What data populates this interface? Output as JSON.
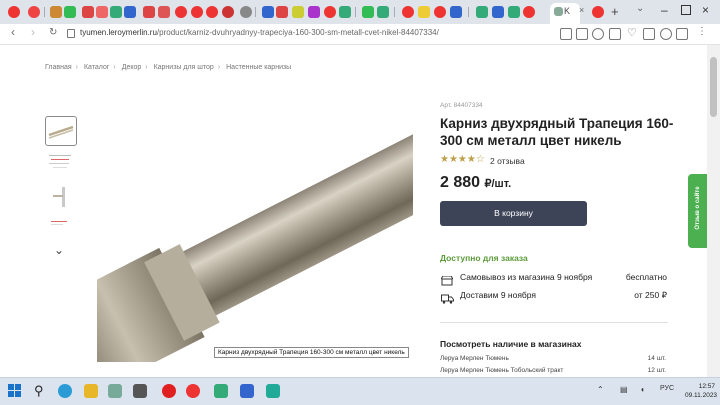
{
  "browser": {
    "active_tab_label": "K",
    "url_domain": "tyumen.leroymerlin.ru",
    "url_path": "/product/karniz-dvuhryadnyy-trapeciya-160-300-sm-metall-cvet-nikel-84407334/"
  },
  "breadcrumb": [
    "Главная",
    "Каталог",
    "Декор",
    "Карнизы для штор",
    "Настенные карнизы"
  ],
  "product": {
    "sku": "Арт. 84407334",
    "title": "Карниз двухрядный Трапеция 160-300 см металл цвет никель",
    "rating_stars": "★★★★☆",
    "rating": 3.5,
    "reviews": "2 отзыва",
    "price": "2 880",
    "price_unit": "₽/шт.",
    "cart_button": "В корзину",
    "availability": "Доступно для заказа",
    "image_caption": "Карниз двухрядный Трапеция 160-300 см металл цвет никель"
  },
  "delivery": [
    {
      "icon": "store-icon",
      "label": "Самовывоз из магазина 9 ноября",
      "value": "бесплатно"
    },
    {
      "icon": "truck-icon",
      "label": "Доставим 9 ноября",
      "value": "от 250 ₽"
    }
  ],
  "stock": {
    "title": "Посмотреть наличие в магазинах",
    "stores": [
      {
        "name": "Леруа Мерлен Тюмень",
        "qty": "14 шт."
      },
      {
        "name": "Леруа Мерлен Тюмень Тобольский тракт",
        "qty": "12 шт."
      }
    ]
  },
  "feedback_label": "Отзыв о сайте",
  "taskbar": {
    "time": "12:57",
    "date": "09.11.2023"
  },
  "colors": {
    "cart_button": "#3d4457",
    "available_green": "#5c9b3b",
    "feedback_green": "#4caf50",
    "stars": "#bfa04a"
  }
}
